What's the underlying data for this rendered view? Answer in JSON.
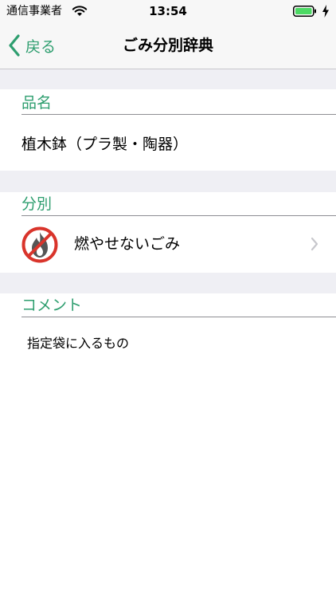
{
  "status_bar": {
    "carrier": "通信事業者",
    "time": "13:54",
    "wifi_icon": "wifi-icon",
    "battery_icon": "battery-icon",
    "charging_icon": "charging-bolt-icon",
    "battery_color": "#4cd964"
  },
  "nav": {
    "back_label": "戻る",
    "title": "ごみ分別辞典",
    "accent_color": "#2e9e6f"
  },
  "sections": {
    "item_name_header": "品名",
    "item_name_value": "植木鉢（プラ製・陶器）",
    "category_header": "分別",
    "category_value": "燃やせないごみ",
    "category_icon": "no-burn-icon",
    "comment_header": "コメント",
    "comment_value": "指定袋に入るもの"
  }
}
